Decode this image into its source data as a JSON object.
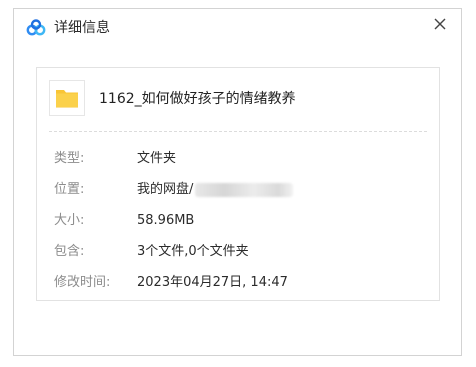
{
  "dialog": {
    "title": "详细信息",
    "close_label": "×"
  },
  "file": {
    "name": "1162_如何做好孩子的情绪教养",
    "icon": "folder-icon"
  },
  "details": {
    "type_label": "类型:",
    "type_value": "文件夹",
    "location_label": "位置:",
    "location_value": "我的网盘/",
    "size_label": "大小:",
    "size_value": "58.96MB",
    "contains_label": "包含:",
    "contains_value": "3个文件,0个文件夹",
    "modified_label": "修改时间:",
    "modified_value": "2023年04月27日, 14:47"
  },
  "colors": {
    "folder": "#f9c535",
    "logo_blue": "#2f8cf2"
  }
}
